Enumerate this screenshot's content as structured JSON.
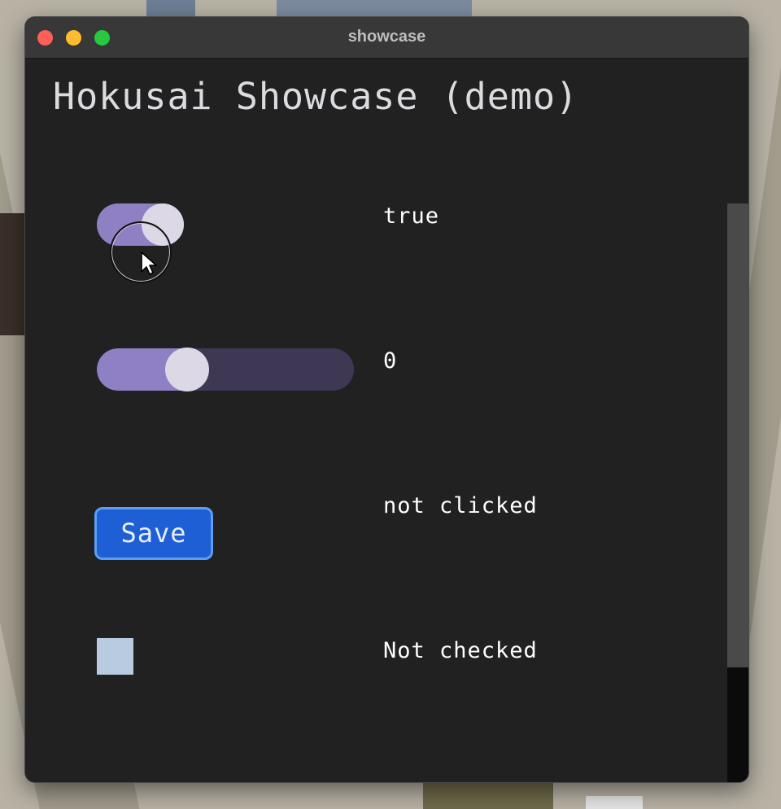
{
  "window": {
    "title": "showcase"
  },
  "app": {
    "heading": "Hokusai Showcase (demo)"
  },
  "toggle": {
    "on": true,
    "value_text": "true"
  },
  "slider": {
    "value": 0.35,
    "value_text": "0"
  },
  "button": {
    "label": "Save",
    "status_text": "not clicked"
  },
  "checkbox": {
    "checked": false,
    "status_text": "Not checked"
  },
  "colors": {
    "accent_purple": "#8f7fc3",
    "track_dark": "#3f3855",
    "knob": "#dcd8e6",
    "button_blue": "#1f5fd6",
    "button_border": "#5c9ef5",
    "checkbox": "#b8cbe0",
    "window_bg": "#212121"
  },
  "icons": {
    "cursor": "pointer-arrow-icon"
  }
}
